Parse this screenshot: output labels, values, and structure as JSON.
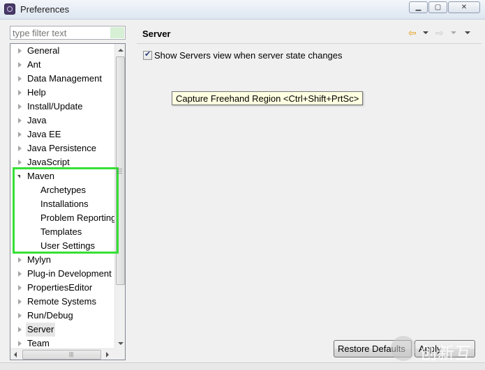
{
  "window": {
    "title": "Preferences"
  },
  "filter": {
    "placeholder": "type filter text"
  },
  "tree": {
    "items": [
      {
        "label": "General"
      },
      {
        "label": "Ant"
      },
      {
        "label": "Data Management"
      },
      {
        "label": "Help"
      },
      {
        "label": "Install/Update"
      },
      {
        "label": "Java"
      },
      {
        "label": "Java EE"
      },
      {
        "label": "Java Persistence"
      },
      {
        "label": "JavaScript"
      },
      {
        "label": "Maven"
      },
      {
        "label": "Archetypes"
      },
      {
        "label": "Installations"
      },
      {
        "label": "Problem Reporting"
      },
      {
        "label": "Templates"
      },
      {
        "label": "User Settings"
      },
      {
        "label": "Mylyn"
      },
      {
        "label": "Plug-in Development"
      },
      {
        "label": "PropertiesEditor"
      },
      {
        "label": "Remote Systems"
      },
      {
        "label": "Run/Debug"
      },
      {
        "label": "Server"
      },
      {
        "label": "Team"
      }
    ],
    "selected": "Server",
    "expanded": "Maven"
  },
  "page": {
    "title": "Server",
    "checkbox_label": "Show Servers view when server state changes",
    "checkbox_checked": true
  },
  "tooltip": {
    "text": "Capture Freehand Region <Ctrl+Shift+PrtSc>"
  },
  "buttons": {
    "restore": "Restore Defaults",
    "apply": "Apply"
  },
  "watermark": {
    "text": "创新互联"
  },
  "icons": {
    "back": "back-arrow-icon",
    "forward": "forward-arrow-icon",
    "menu": "dropdown-menu-icon"
  },
  "colors": {
    "highlight": "#35e035",
    "tooltip_bg": "#ffffe1",
    "back_arrow": "#e39b16"
  }
}
